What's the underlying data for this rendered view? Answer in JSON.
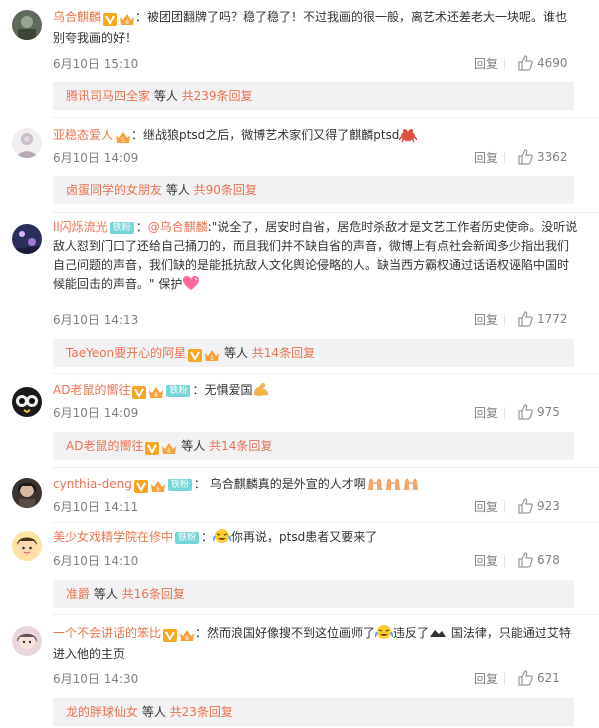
{
  "comments": [
    {
      "user": "乌合麒麟",
      "text": "：被团团翻牌了吗？稳了稳了！不过我画的很一般，离艺术还差老大一块呢。谁也别夸我画的好！",
      "time": "6月10日 15:10",
      "reply_label": "回复",
      "likes": "4690",
      "sub_user": "腾讯司马四全家",
      "sub_etc": " 等人 ",
      "sub_more": "共239条回复"
    },
    {
      "user": "亚稳态爱人",
      "text": "：继战狼ptsd之后，微博艺术家们又得了麒麟ptsd",
      "time": "6月10日 14:09",
      "reply_label": "回复",
      "likes": "3362",
      "sub_user": "卤蛋同学的女朋友",
      "sub_etc": " 等人 ",
      "sub_more": "共90条回复"
    },
    {
      "user": "ll闪烁流光",
      "fan_badge": "铁粉",
      "mention": "@乌合麒麟",
      "text": ":\"说全了，居安时自省，居危时杀敌才是文艺工作者历史使命。没听说敌人怼到门口了还给自己捅刀的，而且我们并不缺自省的声音，微博上有点社会新闻多少指出我们自己问题的声音，我们缺的是能抵抗敌人文化舆论侵略的人。缺当西方霸权通过话语权诬陷中国时候能回击的声音。\" 保护",
      "time": "6月10日 14:13",
      "reply_label": "回复",
      "likes": "1772",
      "sub_user": "TaeYeon要开心的阿星",
      "sub_etc": " 等人 ",
      "sub_more": "共14条回复"
    },
    {
      "user": "AD老鼠的嚮往",
      "fan_badge": "铁粉",
      "text": "：无惧爱国",
      "time": "6月10日 14:09",
      "reply_label": "回复",
      "likes": "975",
      "sub_user": "AD老鼠的嚮往",
      "sub_etc": " 等人 ",
      "sub_more": "共14条回复"
    },
    {
      "user": "cynthia-deng",
      "fan_badge": "铁粉",
      "text": "： 乌合麒麟真的是外宣的人才啊",
      "time": "6月10日 14:11",
      "reply_label": "回复",
      "likes": "923"
    },
    {
      "user": "美少女戏精学院在修中",
      "fan_badge": "铁粉",
      "text": "你再说，ptsd患者又要来了",
      "time": "6月10日 14:10",
      "reply_label": "回复",
      "likes": "678",
      "sub_user": "准爵",
      "sub_etc": " 等人 ",
      "sub_more": "共16条回复"
    },
    {
      "user": "一个不会讲话的笨比",
      "text_a": "：然而浪国好像搜不到这位画师了",
      "text_b": "违反了",
      "text_c": " 国法律，只能通过艾特进入他的主页",
      "time": "6月10日 14:30",
      "reply_label": "回复",
      "likes": "621",
      "sub_user": "龙的胖球仙女",
      "sub_etc": " 等人 ",
      "sub_more": "共23条回复"
    }
  ],
  "colors": {
    "link": "#eb7350",
    "text": "#333333",
    "meta": "#808080",
    "subbox_bg": "#f2f2f5",
    "fan_badge": "#76d5d8",
    "vip_v": "#f5a623",
    "crown": "#f6a13c"
  },
  "icons": [
    "like-thumb-icon",
    "v-verified-icon",
    "vip-crown-icon",
    "heart-emoji",
    "muscle-emoji",
    "hands-emoji",
    "laugh-cry-emoji",
    "crab-emoji",
    "river-crab-emoji"
  ]
}
